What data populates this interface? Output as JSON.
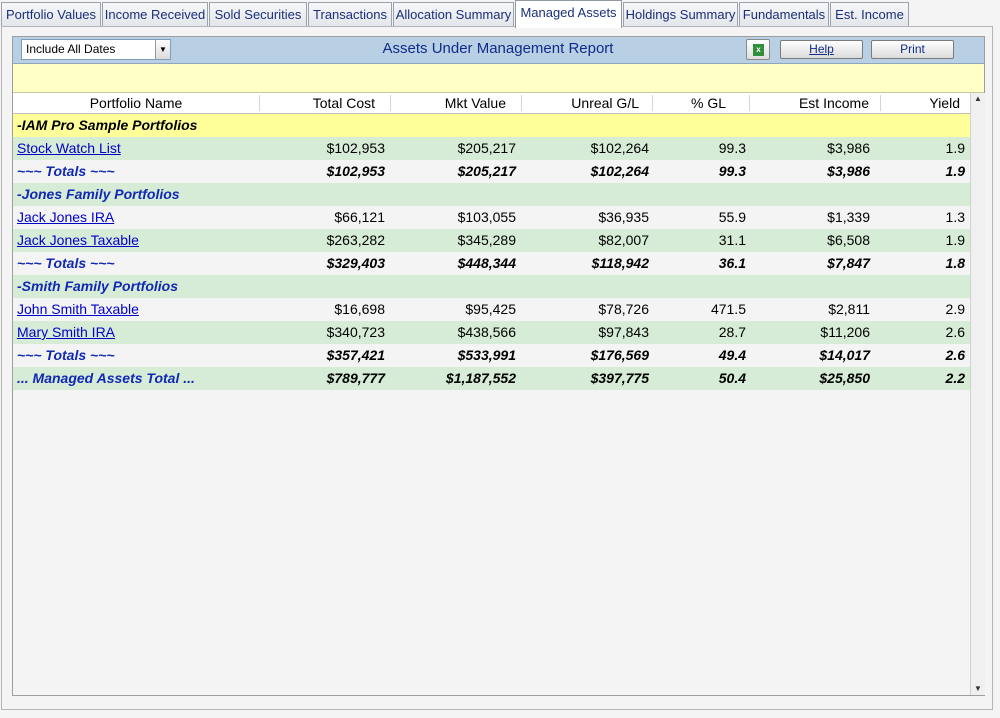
{
  "tabs": [
    {
      "label": "Portfolio Values",
      "active": false
    },
    {
      "label": "Income Received",
      "active": false
    },
    {
      "label": "Sold Securities",
      "active": false
    },
    {
      "label": "Transactions",
      "active": false
    },
    {
      "label": "Allocation Summary",
      "active": false
    },
    {
      "label": "Managed Assets",
      "active": true
    },
    {
      "label": "Holdings Summary",
      "active": false
    },
    {
      "label": "Fundamentals",
      "active": false
    },
    {
      "label": "Est. Income",
      "active": false
    }
  ],
  "toolbar": {
    "date_filter_value": "Include All Dates",
    "report_title": "Assets Under Management Report",
    "excel_icon": "excel-export-icon",
    "help_label": "Help",
    "print_label": "Print"
  },
  "table": {
    "columns": [
      "Portfolio Name",
      "Total Cost",
      "Mkt Value",
      "Unreal G/L",
      "% GL",
      "Est Income",
      "Yield"
    ],
    "rows": [
      {
        "type": "group",
        "style": "yellow",
        "name": "-IAM Pro Sample Portfolios"
      },
      {
        "type": "portfolio",
        "style": "green",
        "name": "Stock Watch List",
        "total_cost": "$102,953",
        "mkt_value": "$205,217",
        "unreal_gl": "$102,264",
        "pct_gl": "99.3",
        "est_income": "$3,986",
        "yield": "1.9"
      },
      {
        "type": "total",
        "style": "white",
        "name": "~~~ Totals ~~~",
        "total_cost": "$102,953",
        "mkt_value": "$205,217",
        "unreal_gl": "$102,264",
        "pct_gl": "99.3",
        "est_income": "$3,986",
        "yield": "1.9"
      },
      {
        "type": "group",
        "style": "green",
        "name": "-Jones Family Portfolios"
      },
      {
        "type": "portfolio",
        "style": "white",
        "name": "Jack Jones IRA",
        "total_cost": "$66,121",
        "mkt_value": "$103,055",
        "unreal_gl": "$36,935",
        "pct_gl": "55.9",
        "est_income": "$1,339",
        "yield": "1.3"
      },
      {
        "type": "portfolio",
        "style": "green",
        "name": "Jack Jones Taxable",
        "total_cost": "$263,282",
        "mkt_value": "$345,289",
        "unreal_gl": "$82,007",
        "pct_gl": "31.1",
        "est_income": "$6,508",
        "yield": "1.9"
      },
      {
        "type": "total",
        "style": "white",
        "name": "~~~ Totals ~~~",
        "total_cost": "$329,403",
        "mkt_value": "$448,344",
        "unreal_gl": "$118,942",
        "pct_gl": "36.1",
        "est_income": "$7,847",
        "yield": "1.8"
      },
      {
        "type": "group",
        "style": "green",
        "name": "-Smith Family Portfolios"
      },
      {
        "type": "portfolio",
        "style": "white",
        "name": "John Smith Taxable",
        "total_cost": "$16,698",
        "mkt_value": "$95,425",
        "unreal_gl": "$78,726",
        "pct_gl": "471.5",
        "est_income": "$2,811",
        "yield": "2.9"
      },
      {
        "type": "portfolio",
        "style": "green",
        "name": "Mary Smith IRA",
        "total_cost": "$340,723",
        "mkt_value": "$438,566",
        "unreal_gl": "$97,843",
        "pct_gl": "28.7",
        "est_income": "$11,206",
        "yield": "2.6"
      },
      {
        "type": "total",
        "style": "white",
        "name": "~~~ Totals ~~~",
        "total_cost": "$357,421",
        "mkt_value": "$533,991",
        "unreal_gl": "$176,569",
        "pct_gl": "49.4",
        "est_income": "$14,017",
        "yield": "2.6"
      },
      {
        "type": "total",
        "style": "green",
        "name": "... Managed Assets Total ...",
        "total_cost": "$789,777",
        "mkt_value": "$1,187,552",
        "unreal_gl": "$397,775",
        "pct_gl": "50.4",
        "est_income": "$25,850",
        "yield": "2.2"
      }
    ]
  },
  "colors": {
    "header_blue": "#b9cfe4",
    "band_yellow": "#ffffc6",
    "row_green": "#d6ecd6",
    "group_yellow": "#ffff99",
    "link_blue": "#0000c8"
  }
}
